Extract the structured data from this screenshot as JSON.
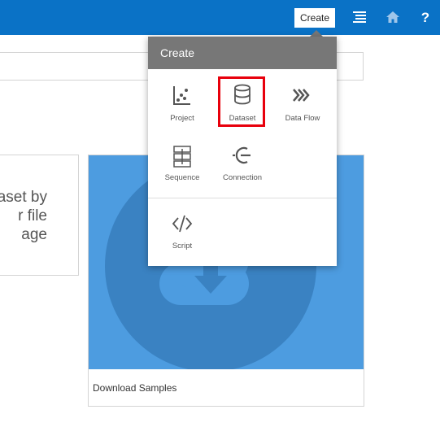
{
  "topbar": {
    "create_label": "Create",
    "menu_icon": "list-menu-icon",
    "home_icon": "home-icon",
    "help_label": "?",
    "color": "#0a72c6"
  },
  "search": {
    "value": ""
  },
  "import_card": {
    "lines": [
      "ataset by",
      "r file",
      "age"
    ]
  },
  "samples_card": {
    "label": "Download Samples",
    "color": "#4d9ce0"
  },
  "create_menu": {
    "header": "Create",
    "items": [
      {
        "label": "Project",
        "icon": "project-chart-icon"
      },
      {
        "label": "Dataset",
        "icon": "database-icon",
        "highlighted": true
      },
      {
        "label": "Data Flow",
        "icon": "data-flow-icon"
      },
      {
        "label": "Sequence",
        "icon": "sequence-icon"
      },
      {
        "label": "Connection",
        "icon": "connection-icon"
      },
      {
        "label": "Script",
        "icon": "script-code-icon"
      }
    ],
    "highlight_color": "#e8000c"
  }
}
